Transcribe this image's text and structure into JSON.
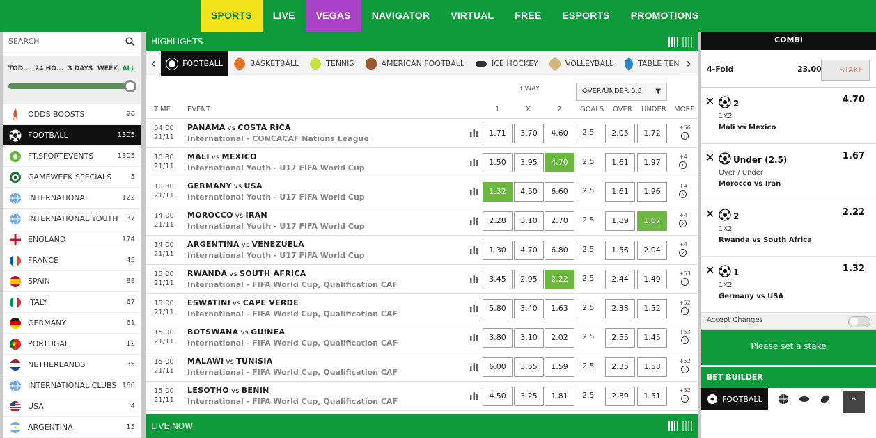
{
  "nav": [
    {
      "label": "SPORTS"
    },
    {
      "label": "LIVE"
    },
    {
      "label": "VEGAS"
    },
    {
      "label": "NAVIGATOR"
    },
    {
      "label": "VIRTUAL"
    },
    {
      "label": "FREE"
    },
    {
      "label": "ESPORTS"
    },
    {
      "label": "PROMOTIONS"
    }
  ],
  "sidebar": {
    "search_placeholder": "SEARCH",
    "periods": [
      "TOD...",
      "24 HO...",
      "3 DAYS",
      "WEEK",
      "ALL"
    ],
    "items": [
      {
        "label": "ODDS BOOSTS",
        "count": "90"
      },
      {
        "label": "FOOTBALL",
        "count": "1305"
      },
      {
        "label": "FT.SPORTEVENTS",
        "count": "1305"
      },
      {
        "label": "GAMEWEEK SPECIALS",
        "count": "5"
      },
      {
        "label": "INTERNATIONAL",
        "count": "122"
      },
      {
        "label": "INTERNATIONAL YOUTH",
        "count": "37"
      },
      {
        "label": "ENGLAND",
        "count": "174"
      },
      {
        "label": "FRANCE",
        "count": "45"
      },
      {
        "label": "SPAIN",
        "count": "88"
      },
      {
        "label": "ITALY",
        "count": "67"
      },
      {
        "label": "GERMANY",
        "count": "61"
      },
      {
        "label": "PORTUGAL",
        "count": "12"
      },
      {
        "label": "NETHERLANDS",
        "count": "35"
      },
      {
        "label": "INTERNATIONAL CLUBS",
        "count": "160"
      },
      {
        "label": "USA",
        "count": "4"
      },
      {
        "label": "ARGENTINA",
        "count": "15"
      }
    ]
  },
  "main": {
    "highlights_title": "HIGHLIGHTS",
    "tabs": [
      {
        "label": "FOOTBALL"
      },
      {
        "label": "BASKETBALL"
      },
      {
        "label": "TENNIS"
      },
      {
        "label": "AMERICAN FOOTBALL"
      },
      {
        "label": "ICE HOCKEY"
      },
      {
        "label": "VOLLEYBALL"
      },
      {
        "label": "TABLE TENNIS"
      }
    ],
    "three_way": "3 WAY",
    "ou_select": "OVER/UNDER 0.5",
    "columns": {
      "time": "TIME",
      "event": "EVENT",
      "c1": "1",
      "cx": "X",
      "c2": "2",
      "goals": "GOALS",
      "over": "OVER",
      "under": "UNDER",
      "more": "MORE"
    },
    "events": [
      {
        "time": "04:00",
        "date": "21/11",
        "home": "PANAMA",
        "vs": "vs",
        "away": "COSTA RICA",
        "comp": "International - CONCACAF Nations League",
        "o1": "1.71",
        "ox": "3.70",
        "o2": "4.60",
        "goals": "2.5",
        "over": "2.05",
        "under": "1.72",
        "more": "+56"
      },
      {
        "time": "10:30",
        "date": "21/11",
        "home": "MALI",
        "vs": "vs",
        "away": "MEXICO",
        "comp": "International Youth - U17 FIFA World Cup",
        "o1": "1.50",
        "ox": "3.95",
        "o2": "4.70",
        "goals": "2.5",
        "over": "1.61",
        "under": "1.97",
        "more": "+4"
      },
      {
        "time": "10:30",
        "date": "21/11",
        "home": "GERMANY",
        "vs": "vs",
        "away": "USA",
        "comp": "International Youth - U17 FIFA World Cup",
        "o1": "1.32",
        "ox": "4.50",
        "o2": "6.60",
        "goals": "2.5",
        "over": "1.61",
        "under": "1.96",
        "more": "+4"
      },
      {
        "time": "14:00",
        "date": "21/11",
        "home": "MOROCCO",
        "vs": "vs",
        "away": "IRAN",
        "comp": "International Youth - U17 FIFA World Cup",
        "o1": "2.28",
        "ox": "3.10",
        "o2": "2.70",
        "goals": "2.5",
        "over": "1.89",
        "under": "1.67",
        "more": "+4"
      },
      {
        "time": "14:00",
        "date": "21/11",
        "home": "ARGENTINA",
        "vs": "vs",
        "away": "VENEZUELA",
        "comp": "International Youth - U17 FIFA World Cup",
        "o1": "1.30",
        "ox": "4.70",
        "o2": "6.80",
        "goals": "2.5",
        "over": "1.56",
        "under": "2.04",
        "more": "+4"
      },
      {
        "time": "15:00",
        "date": "21/11",
        "home": "RWANDA",
        "vs": "vs",
        "away": "SOUTH AFRICA",
        "comp": "International - FIFA World Cup, Qualification CAF",
        "o1": "3.45",
        "ox": "2.95",
        "o2": "2.22",
        "goals": "2.5",
        "over": "2.44",
        "under": "1.49",
        "more": "+53"
      },
      {
        "time": "15:00",
        "date": "21/11",
        "home": "ESWATINI",
        "vs": "vs",
        "away": "CAPE VERDE",
        "comp": "International - FIFA World Cup, Qualification CAF",
        "o1": "5.80",
        "ox": "3.40",
        "o2": "1.63",
        "goals": "2.5",
        "over": "2.38",
        "under": "1.52",
        "more": "+52"
      },
      {
        "time": "15:00",
        "date": "21/11",
        "home": "BOTSWANA",
        "vs": "vs",
        "away": "GUINEA",
        "comp": "International - FIFA World Cup, Qualification CAF",
        "o1": "3.80",
        "ox": "3.10",
        "o2": "2.02",
        "goals": "2.5",
        "over": "2.55",
        "under": "1.45",
        "more": "+53"
      },
      {
        "time": "15:00",
        "date": "21/11",
        "home": "MALAWI",
        "vs": "vs",
        "away": "TUNISIA",
        "comp": "International - FIFA World Cup, Qualification CAF",
        "o1": "6.00",
        "ox": "3.55",
        "o2": "1.59",
        "goals": "2.5",
        "over": "2.35",
        "under": "1.53",
        "more": "+52"
      },
      {
        "time": "15:00",
        "date": "21/11",
        "home": "LESOTHO",
        "vs": "vs",
        "away": "BENIN",
        "comp": "International - FIFA World Cup, Qualification CAF",
        "o1": "4.50",
        "ox": "3.25",
        "o2": "1.81",
        "goals": "2.5",
        "over": "2.39",
        "under": "1.51",
        "more": "+52"
      }
    ],
    "live_now": "LIVE NOW"
  },
  "slip": {
    "combi": "COMBI",
    "fold_label": "4-Fold",
    "fold_odds": "23.00",
    "stake_placeholder": "STAKE",
    "bets": [
      {
        "selection": "2",
        "odds": "4.70",
        "market": "1X2",
        "event": "Mali vs Mexico"
      },
      {
        "selection": "Under (2.5)",
        "odds": "1.67",
        "market": "Over / Under",
        "event": "Morocco vs Iran"
      },
      {
        "selection": "2",
        "odds": "2.22",
        "market": "1X2",
        "event": "Rwanda vs South Africa"
      },
      {
        "selection": "1",
        "odds": "1.32",
        "market": "1X2",
        "event": "Germany vs USA"
      }
    ],
    "accept_changes": "Accept Changes",
    "set_stake": "Please set a stake",
    "bet_builder": "BET BUILDER",
    "bb_tab": "FOOTBALL"
  },
  "colors": {
    "brand_green": "#0f9a3c",
    "selected_odd": "#6cb840",
    "sports_tab": "#f3e419",
    "vegas_tab": "#a943c8"
  }
}
